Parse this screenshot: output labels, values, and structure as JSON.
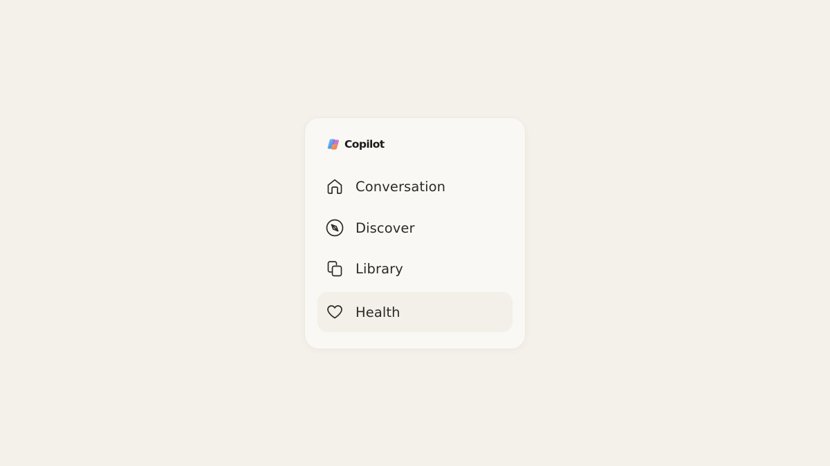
{
  "app": {
    "brand_name": "Copilot",
    "brand_logo": "copilot-logo"
  },
  "nav": {
    "items": [
      {
        "label": "Conversation",
        "icon": "home-icon",
        "active": false
      },
      {
        "label": "Discover",
        "icon": "compass-icon",
        "active": false
      },
      {
        "label": "Library",
        "icon": "library-icon",
        "active": false
      },
      {
        "label": "Health",
        "icon": "heart-icon",
        "active": true
      }
    ]
  },
  "colors": {
    "page_background": "#f4f0ea",
    "card_background": "#faf8f4",
    "active_item_background": "#f3efe9",
    "text": "#2b2a28"
  }
}
